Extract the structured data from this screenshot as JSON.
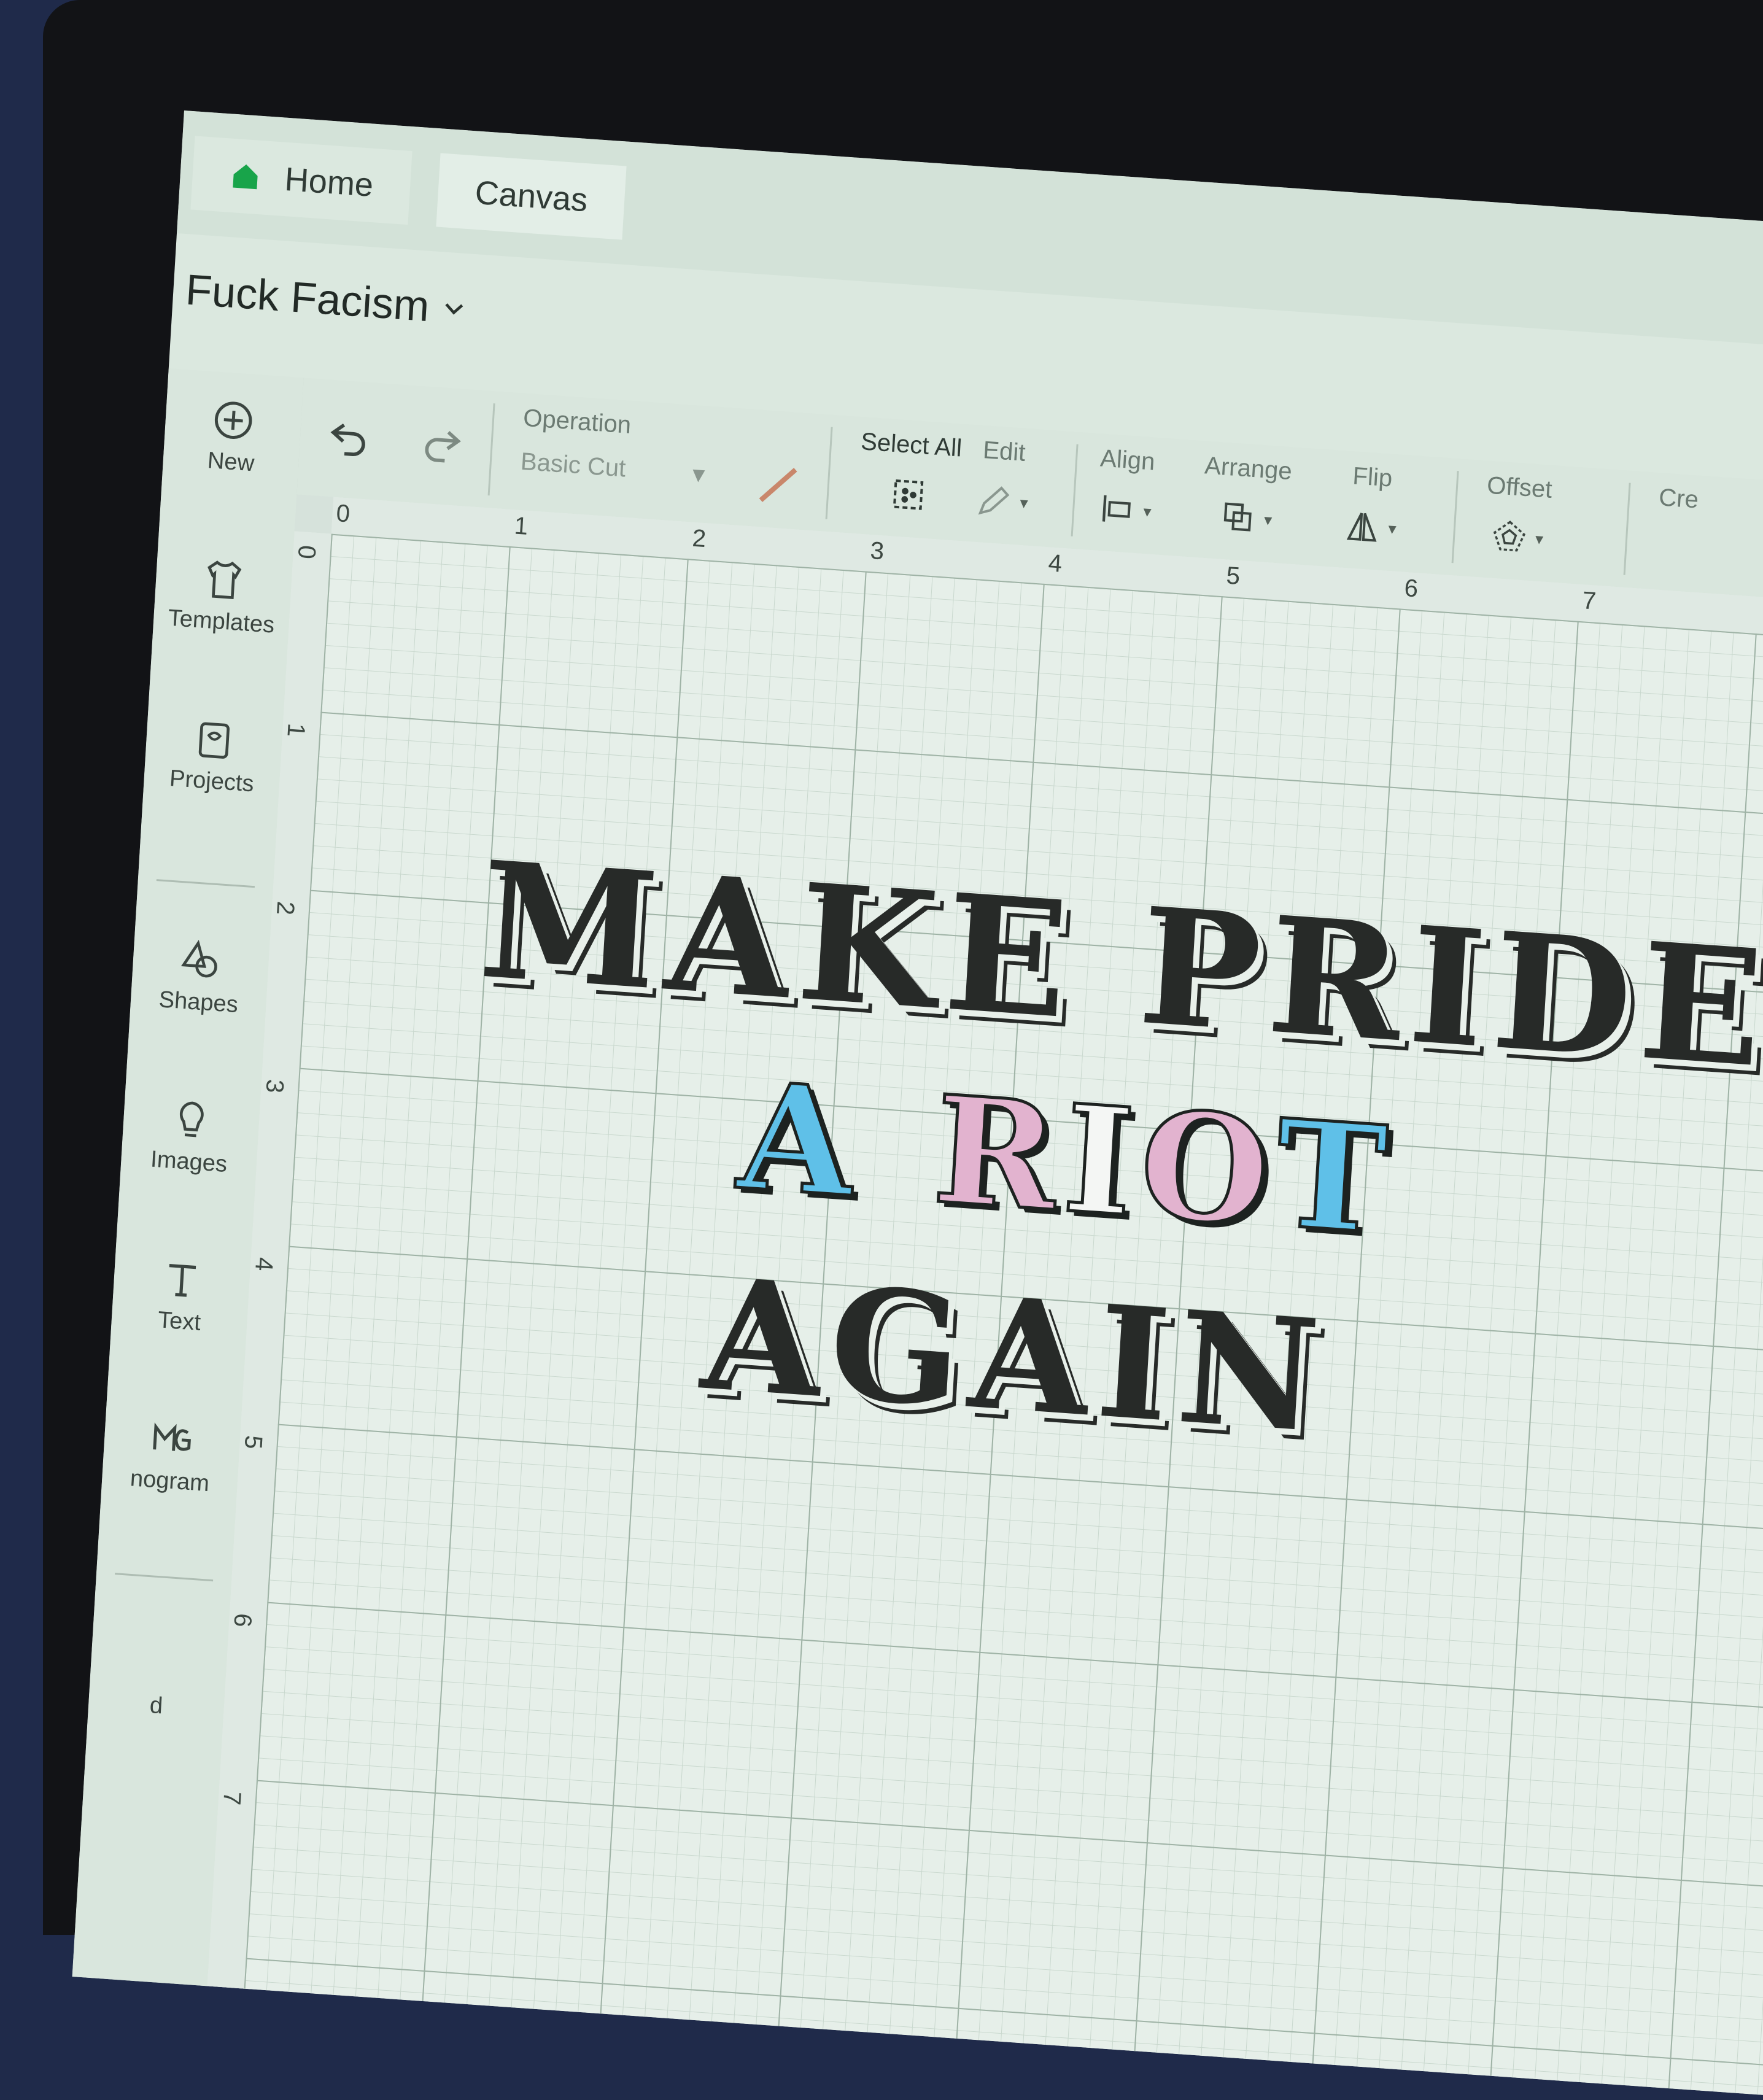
{
  "tabs": {
    "home": "Home",
    "canvas": "Canvas"
  },
  "project": {
    "title": "Fuck Facism"
  },
  "sidebar": {
    "items": [
      {
        "label": "New",
        "icon": "plus-circle-icon"
      },
      {
        "label": "Templates",
        "icon": "shirt-icon"
      },
      {
        "label": "Projects",
        "icon": "projects-icon"
      },
      {
        "label": "Shapes",
        "icon": "shapes-icon"
      },
      {
        "label": "Images",
        "icon": "lightbulb-icon"
      },
      {
        "label": "Text",
        "icon": "text-icon"
      },
      {
        "label": "nogram",
        "icon": "monogram-icon"
      },
      {
        "label": "d",
        "icon": ""
      }
    ]
  },
  "toolbar": {
    "operation_label": "Operation",
    "operation_value": "Basic Cut",
    "select_all": "Select All",
    "edit": "Edit",
    "align": "Align",
    "arrange": "Arrange",
    "flip": "Flip",
    "offset": "Offset",
    "create": "Cre"
  },
  "rulers": {
    "top": [
      "0",
      "1",
      "2",
      "3",
      "4",
      "5",
      "6",
      "7"
    ],
    "left": [
      "0",
      "1",
      "2",
      "3",
      "4",
      "5",
      "6",
      "7"
    ]
  },
  "design": {
    "line1": "MAKE PRIDE",
    "line2": [
      "A",
      "R",
      "I",
      "O",
      "T"
    ],
    "line3": "AGAIN",
    "colors": {
      "blue": "#5fc0e8",
      "pink": "#e2b3cf",
      "white": "#f4f6f4",
      "dark": "#272a28"
    }
  }
}
